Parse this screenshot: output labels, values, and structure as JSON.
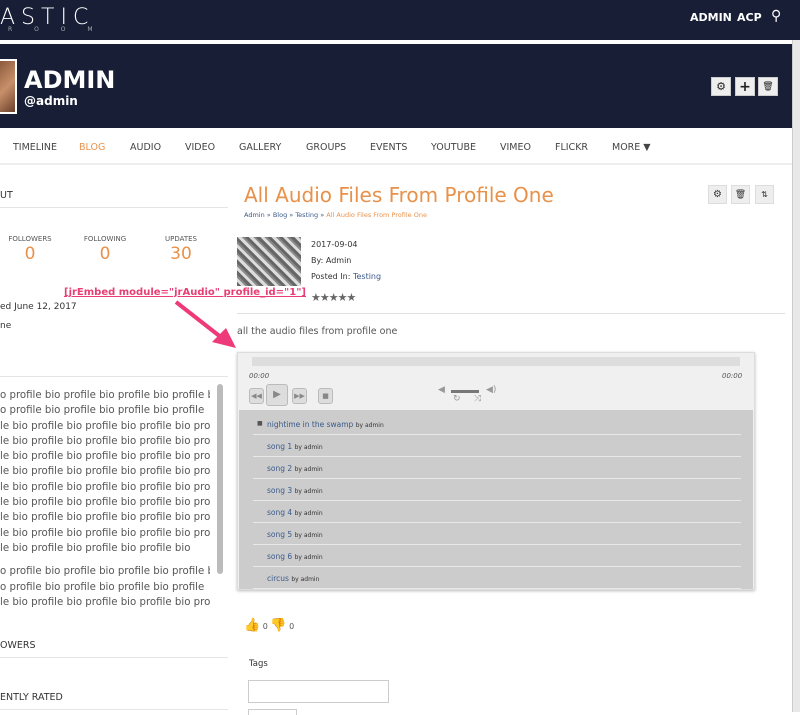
{
  "topbar": {
    "logo": "ASTIC",
    "logo_sub": "R O O M",
    "links": [
      "ADMIN",
      "ACP"
    ]
  },
  "profile": {
    "name": "ADMIN",
    "handle": "@admin",
    "buttons": [
      "⚙",
      "+",
      "🗑"
    ]
  },
  "nav": [
    "TIMELINE",
    "BLOG",
    "AUDIO",
    "VIDEO",
    "GALLERY",
    "GROUPS",
    "EVENTS",
    "YOUTUBE",
    "VIMEO",
    "FLICKR",
    "MORE ▼"
  ],
  "sidebar": {
    "about_heading": "UT",
    "stats": [
      {
        "label": "FOLLOWERS",
        "value": "0"
      },
      {
        "label": "FOLLOWING",
        "value": "0"
      },
      {
        "label": "UPDATES",
        "value": "30"
      }
    ],
    "joined": "ed June 12, 2017",
    "line2": "ne",
    "bio": [
      "o profile bio profile bio profile bio profile bio",
      "o profile bio profile bio profile bio profile",
      "le bio profile bio profile bio profile bio profile",
      "le bio profile bio profile bio profile bio profile",
      "le bio profile bio profile bio profile bio profile",
      "le bio profile bio profile bio profile bio profile",
      "le bio profile bio profile bio profile bio profile",
      "le bio profile bio profile bio profile bio profile",
      "le bio profile bio profile bio profile bio profile",
      "le bio profile bio profile bio profile bio profile",
      "le bio profile bio profile bio profile bio",
      "",
      "o profile bio profile bio profile bio profile bio",
      "o profile bio profile bio profile bio profile",
      "le bio profile bio profile bio profile bio profile"
    ],
    "followers_heading": "OWERS",
    "rated_heading": "ENTLY RATED"
  },
  "post": {
    "title": "All Audio Files From Profile One",
    "breadcrumb": [
      "Admin",
      "Blog",
      "Testing",
      "All Audio Files From Profile One"
    ],
    "date": "2017-09-04",
    "by": "By: Admin",
    "posted_in_label": "Posted In: ",
    "posted_in": "Testing",
    "stars": "★★★★★",
    "description": "all the audio files from profile one",
    "annotation": "[jrEmbed module=\"jrAudio\" profile_id=\"1\"]"
  },
  "player": {
    "time_current": "00:00",
    "time_total": "00:00",
    "tracks": [
      {
        "title": "nightime in the swamp",
        "by": "by admin"
      },
      {
        "title": "song 1",
        "by": "by admin"
      },
      {
        "title": "song 2",
        "by": "by admin"
      },
      {
        "title": "song 3",
        "by": "by admin"
      },
      {
        "title": "song 4",
        "by": "by admin"
      },
      {
        "title": "song 5",
        "by": "by admin"
      },
      {
        "title": "song 6",
        "by": "by admin"
      },
      {
        "title": "circus",
        "by": "by admin"
      }
    ]
  },
  "votes": {
    "up": "0",
    "down": "0"
  },
  "tags": {
    "label": "Tags"
  }
}
